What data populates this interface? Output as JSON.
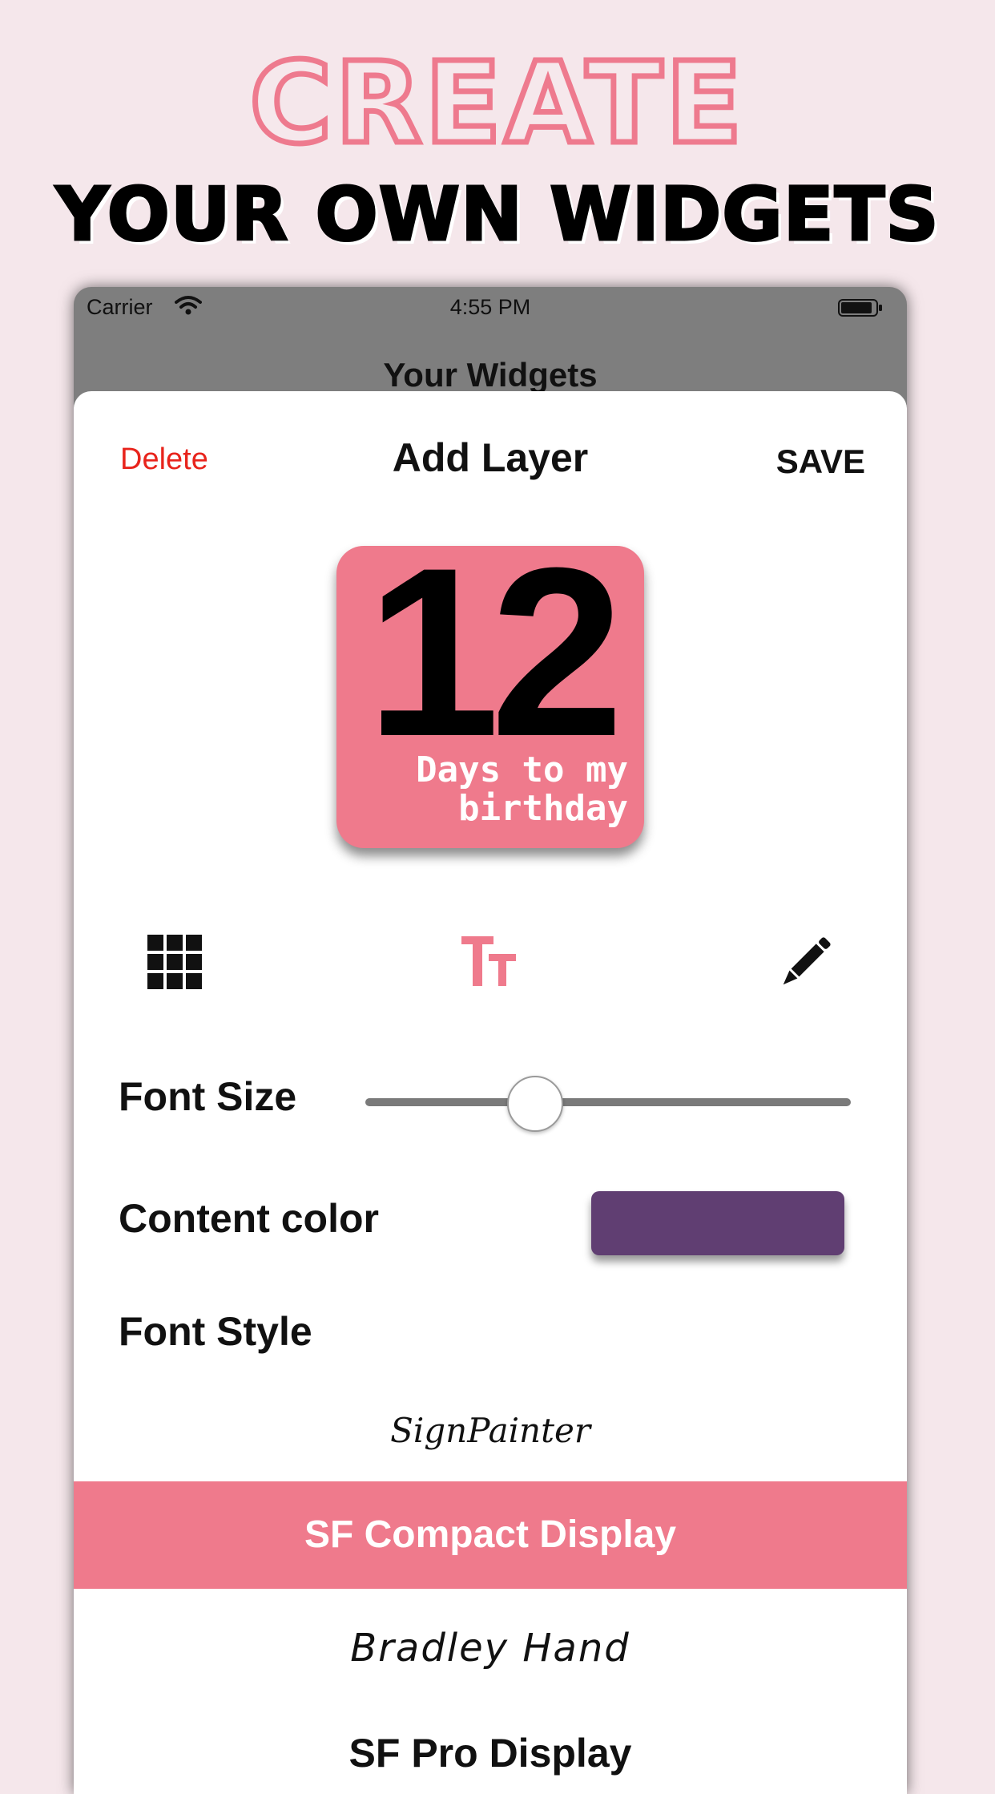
{
  "promo": {
    "headline_top": "CREATE",
    "headline_bottom": "YOUR OWN WIDGETS"
  },
  "status_bar": {
    "carrier": "Carrier",
    "time": "4:55 PM"
  },
  "background_screen": {
    "title": "Your Widgets"
  },
  "sheet": {
    "delete_label": "Delete",
    "title": "Add Layer",
    "save_label": "SAVE"
  },
  "preview": {
    "number": "12",
    "caption": "Days to my birthday",
    "background_color": "#ef7a8c"
  },
  "toolbar": {
    "icons": [
      "grid-icon",
      "text-size-icon",
      "pencil-icon"
    ],
    "active_icon": "text-size-icon",
    "active_color": "#ef7a8c"
  },
  "settings": {
    "font_size_label": "Font Size",
    "font_size_value": 0.35,
    "content_color_label": "Content color",
    "content_color": "#603e72",
    "font_style_label": "Font Style"
  },
  "font_picker": {
    "options": [
      "SignPainter",
      "SF Compact Display",
      "Bradley Hand",
      "SF Pro Display"
    ],
    "selected": "SF Compact Display"
  },
  "colors": {
    "accent": "#ef7a8c",
    "delete": "#e8241c",
    "page_background": "#f5e7eb"
  }
}
